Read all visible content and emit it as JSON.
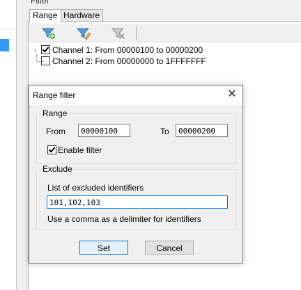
{
  "filter": {
    "title": "Filter"
  },
  "tabs": [
    {
      "label": "Range",
      "active": true
    },
    {
      "label": "Hardware",
      "active": false
    }
  ],
  "toolbar": {
    "buttons": [
      {
        "icon": "add-filter-icon"
      },
      {
        "icon": "edit-filter-icon"
      },
      {
        "icon": "delete-filter-icon"
      }
    ]
  },
  "tree": {
    "channels": [
      {
        "label": "Channel 1: From 00000100 to 00000200",
        "checked": true
      },
      {
        "label": "Channel 2: From 00000000 to 1FFFFFFF",
        "checked": false
      }
    ]
  },
  "dialog": {
    "title": "Range filter",
    "close_glyph": "✕",
    "range": {
      "group_label": "Range",
      "from_label": "From",
      "from_value": "00000100",
      "to_label": "To",
      "to_value": "00000200",
      "enable_label": "Enable filter",
      "enable_checked": true
    },
    "exclude": {
      "group_label": "Exclude",
      "list_label": "List of excluded identifiers",
      "list_value": "101,102,103",
      "hint": "Use a comma as a delimiter for identifiers"
    },
    "set_label": "Set",
    "cancel_label": "Cancel"
  },
  "colors": {
    "accent": "#0078d7",
    "selection": "#3399ff"
  }
}
